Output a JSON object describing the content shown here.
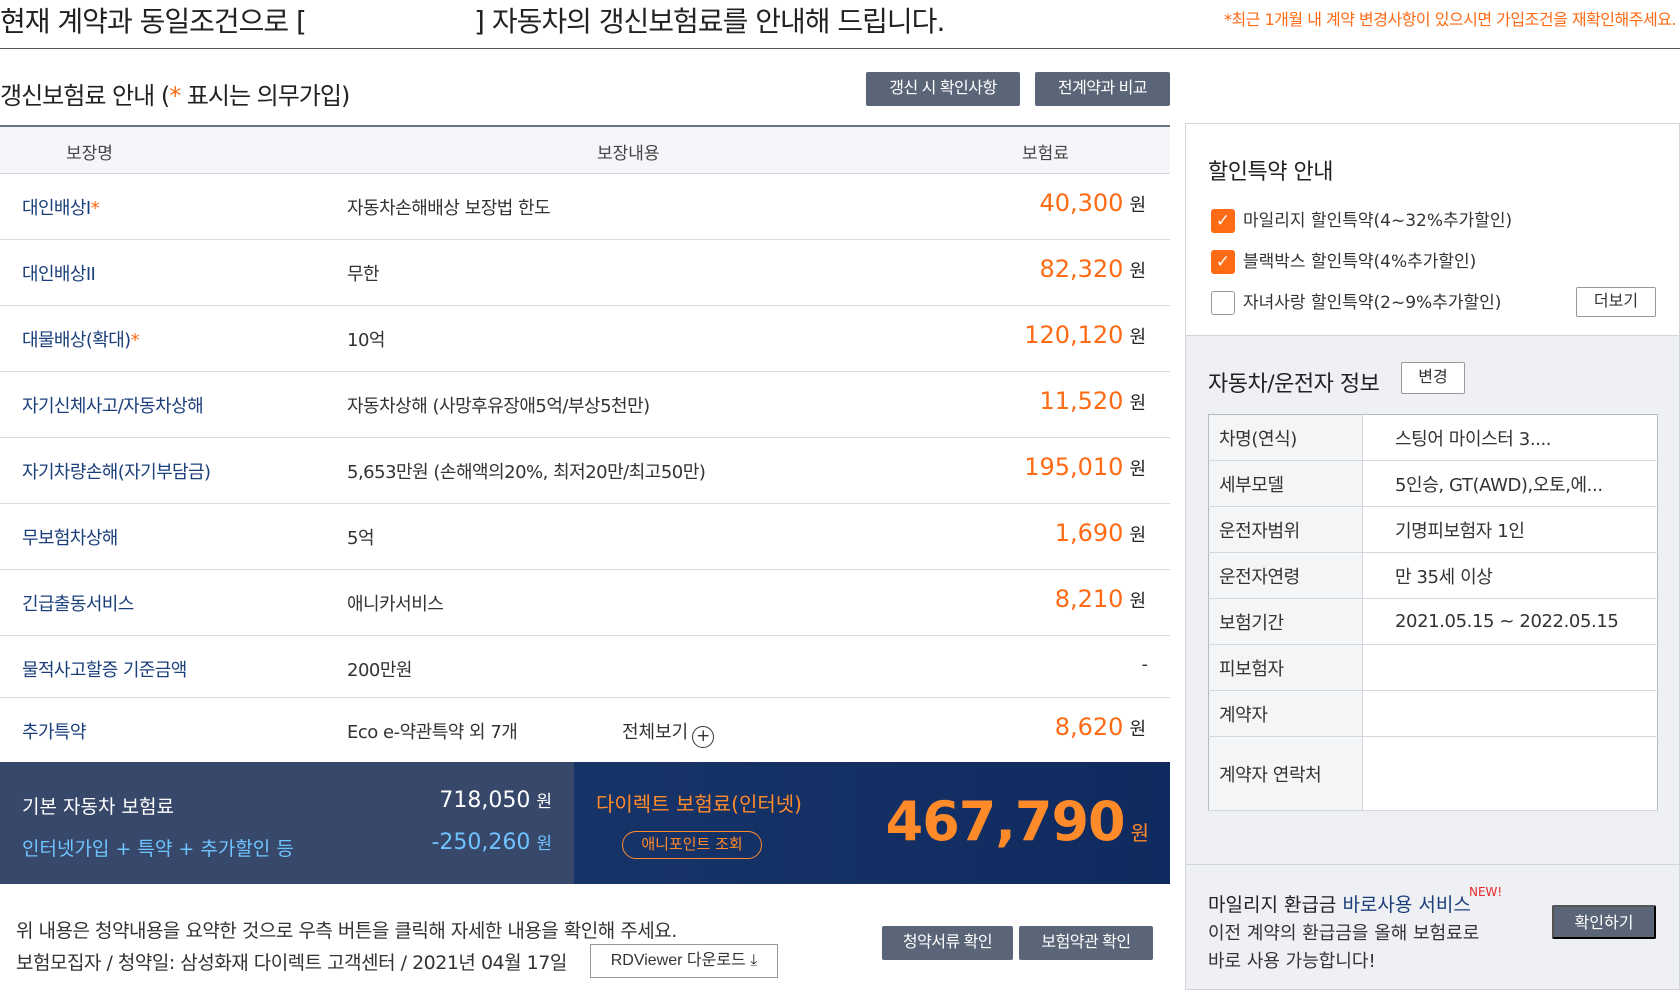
{
  "header": {
    "headline_left": "현재 계약과 동일조건으로 [",
    "headline_right": "] 자동차의 갱신보험료를 안내해 드립니다.",
    "notice": "*최근 1개월 내 계약 변경사항이 있으시면 가입조건을 재확인해주세요."
  },
  "section": {
    "title_prefix": "갱신보험료 안내 (",
    "title_star": "*",
    "title_suffix": " 표시는 의무가입)",
    "renew_button": "갱신 시 확인사항",
    "compare_button": "전계약과 비교"
  },
  "table": {
    "headers": [
      "보장명",
      "보장내용",
      "보험료"
    ],
    "won": "원",
    "rows": [
      {
        "name": "대인배상I",
        "star": "*",
        "desc": "자동차손해배상 보장법 한도",
        "amount": "40,300"
      },
      {
        "name": "대인배상II",
        "star": "",
        "desc": "무한",
        "amount": "82,320"
      },
      {
        "name": "대물배상(확대)",
        "star": "*",
        "desc": "10억",
        "amount": "120,120"
      },
      {
        "name": "자기신체사고/자동차상해",
        "star": "",
        "desc": "자동차상해 (사망후유장애5억/부상5천만)",
        "amount": "11,520"
      },
      {
        "name": "자기차량손해(자기부담금)",
        "star": "",
        "desc": "5,653만원 (손해액의20%, 최저20만/최고50만)",
        "amount": "195,010"
      },
      {
        "name": "무보험차상해",
        "star": "",
        "desc": "5억",
        "amount": "1,690"
      },
      {
        "name": "긴급출동서비스",
        "star": "",
        "desc": "애니카서비스",
        "amount": "8,210"
      },
      {
        "name": "물적사고할증 기준금액",
        "star": "",
        "desc": "200만원",
        "amount": "-"
      },
      {
        "name": "추가특약",
        "star": "",
        "desc": "Eco e-약관특약 외 7개",
        "amount": "8,620"
      }
    ],
    "view_all": "전체보기",
    "view_all_icon": "plus-circle-icon"
  },
  "totals": {
    "base_label": "기본 자동차 보험료",
    "base_value": "718,050",
    "discount_label": "인터넷가입 + 특약 + 추가할인 등",
    "discount_value": "-250,260",
    "won": "원",
    "direct_label": "다이렉트 보험료(인터넷)",
    "anypoint_button": "애니포인트 조회",
    "direct_total": "467,790"
  },
  "footer": {
    "line1": "위 내용은 청약내용을 요약한 것으로 우측 버튼을 클릭해 자세한 내용을 확인해 주세요.",
    "line2": "보험모집자 / 청약일: 삼성화재 다이렉트 고객센터 / 2021년 04월 17일",
    "rdviewer_button": "RDViewer 다운로드",
    "rdviewer_icon": "download-icon",
    "doc_button": "청약서류 확인",
    "terms_button": "보험약관 확인"
  },
  "discounts": {
    "title": "할인특약 안내",
    "items": [
      {
        "label": "마일리지 할인특약(4~32%추가할인)",
        "checked": true
      },
      {
        "label": "블랙박스 할인특약(4%추가할인)",
        "checked": true
      },
      {
        "label": "자녀사랑 할인특약(2~9%추가할인)",
        "checked": false
      }
    ],
    "more_button": "더보기"
  },
  "car_info": {
    "title": "자동차/운전자 정보",
    "change_button": "변경",
    "rows": [
      {
        "key": "차명(연식)",
        "value": "스팅어 마이스터 3...."
      },
      {
        "key": "세부모델",
        "value": "5인승, GT(AWD),오토,에..."
      },
      {
        "key": "운전자범위",
        "value": "기명피보험자 1인"
      },
      {
        "key": "운전자연령",
        "value": "만 35세 이상"
      },
      {
        "key": "보험기간",
        "value": "2021.05.15 ~ 2022.05.15"
      },
      {
        "key": "피보험자",
        "value": ""
      },
      {
        "key": "계약자",
        "value": ""
      },
      {
        "key": "계약자 연락처",
        "value": ""
      }
    ]
  },
  "mileage": {
    "title_plain": "마일리지 환급금 ",
    "title_blue": "바로사용 서비스",
    "new_badge": "NEW!",
    "desc1": "이전 계약의 환급금을 올해 보험료로",
    "desc2": "바로 사용 가능합니다!",
    "button": "확인하기"
  },
  "colors": {
    "accent_orange": "#ff6a14",
    "navy": "#1b3f7b",
    "button_gray": "#5a6577",
    "band_dark": "#37486a"
  }
}
